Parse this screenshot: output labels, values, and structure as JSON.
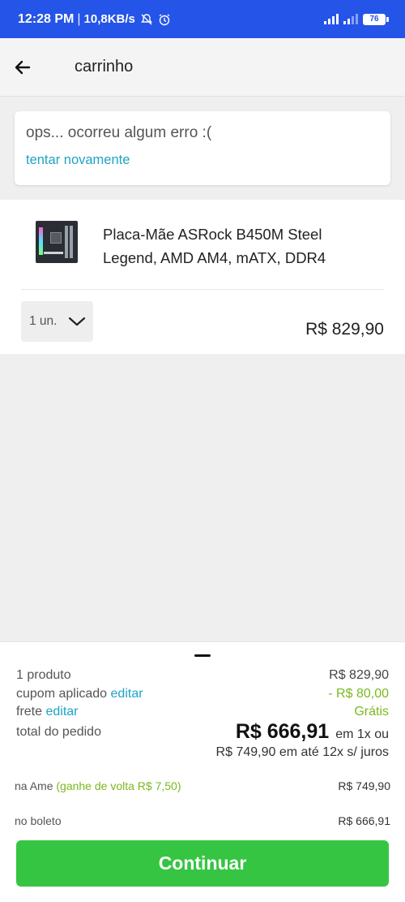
{
  "status_bar": {
    "time": "12:28 PM",
    "separator": "|",
    "speed": "10,8KB/s",
    "battery": "76"
  },
  "app_bar": {
    "back_icon": "arrow-left-icon",
    "title": "carrinho"
  },
  "error": {
    "message": "ops... ocorreu algum erro :(",
    "retry_label": "tentar novamente"
  },
  "product": {
    "name": "Placa-Mãe ASRock B450M Steel Legend, AMD AM4, mATX, DDR4",
    "quantity": "1 un.",
    "price": "R$ 829,90"
  },
  "summary": {
    "products_label": "1 produto",
    "products_value": "R$ 829,90",
    "coupon_label": "cupom aplicado",
    "coupon_edit": "editar",
    "coupon_value": "- R$ 80,00",
    "shipping_label": "frete",
    "shipping_edit": "editar",
    "shipping_value": "Grátis",
    "total_label": "total do pedido",
    "total_value": "R$ 666,91",
    "total_suffix": "em 1x ou",
    "installments": "R$ 749,90 em até 12x s/ juros",
    "ame_label": "na Ame",
    "ame_cashback": "(ganhe de volta R$ 7,50)",
    "ame_value": "R$ 749,90",
    "boleto_label": "no boleto",
    "boleto_value": "R$ 666,91"
  },
  "cta": {
    "continue_label": "Continuar"
  },
  "colors": {
    "status_bar": "#2554e8",
    "link": "#1ea3c4",
    "green_text": "#7cb81e",
    "button": "#36c542"
  }
}
